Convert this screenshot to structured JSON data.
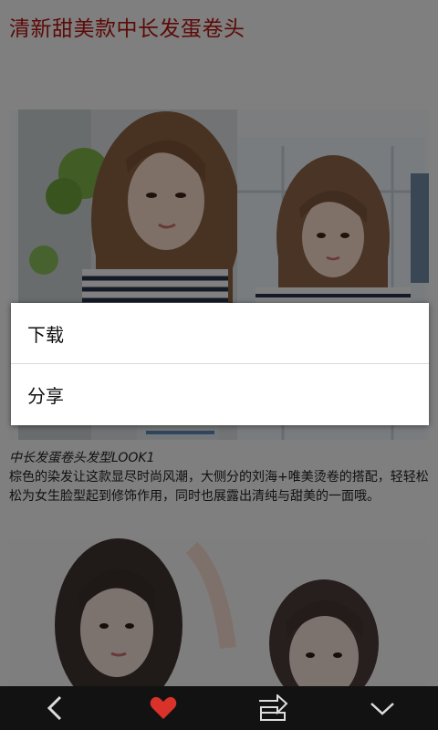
{
  "page": {
    "title": "清新甜美款中长发蛋卷头"
  },
  "caption": {
    "heading": "中长发蛋卷头发型LOOK1",
    "body": "棕色的染发让这款显尽时尚风潮，大侧分的刘海+唯美烫卷的搭配，轻轻松松为女生脸型起到修饰作用，同时也展露出清纯与甜美的一面哦。"
  },
  "menu": {
    "items": [
      {
        "label": "下载"
      },
      {
        "label": "分享"
      }
    ]
  },
  "nav": {
    "icons": [
      "back-icon",
      "heart-icon",
      "share-icon",
      "collapse-icon"
    ],
    "heart_color": "#d9322b"
  }
}
